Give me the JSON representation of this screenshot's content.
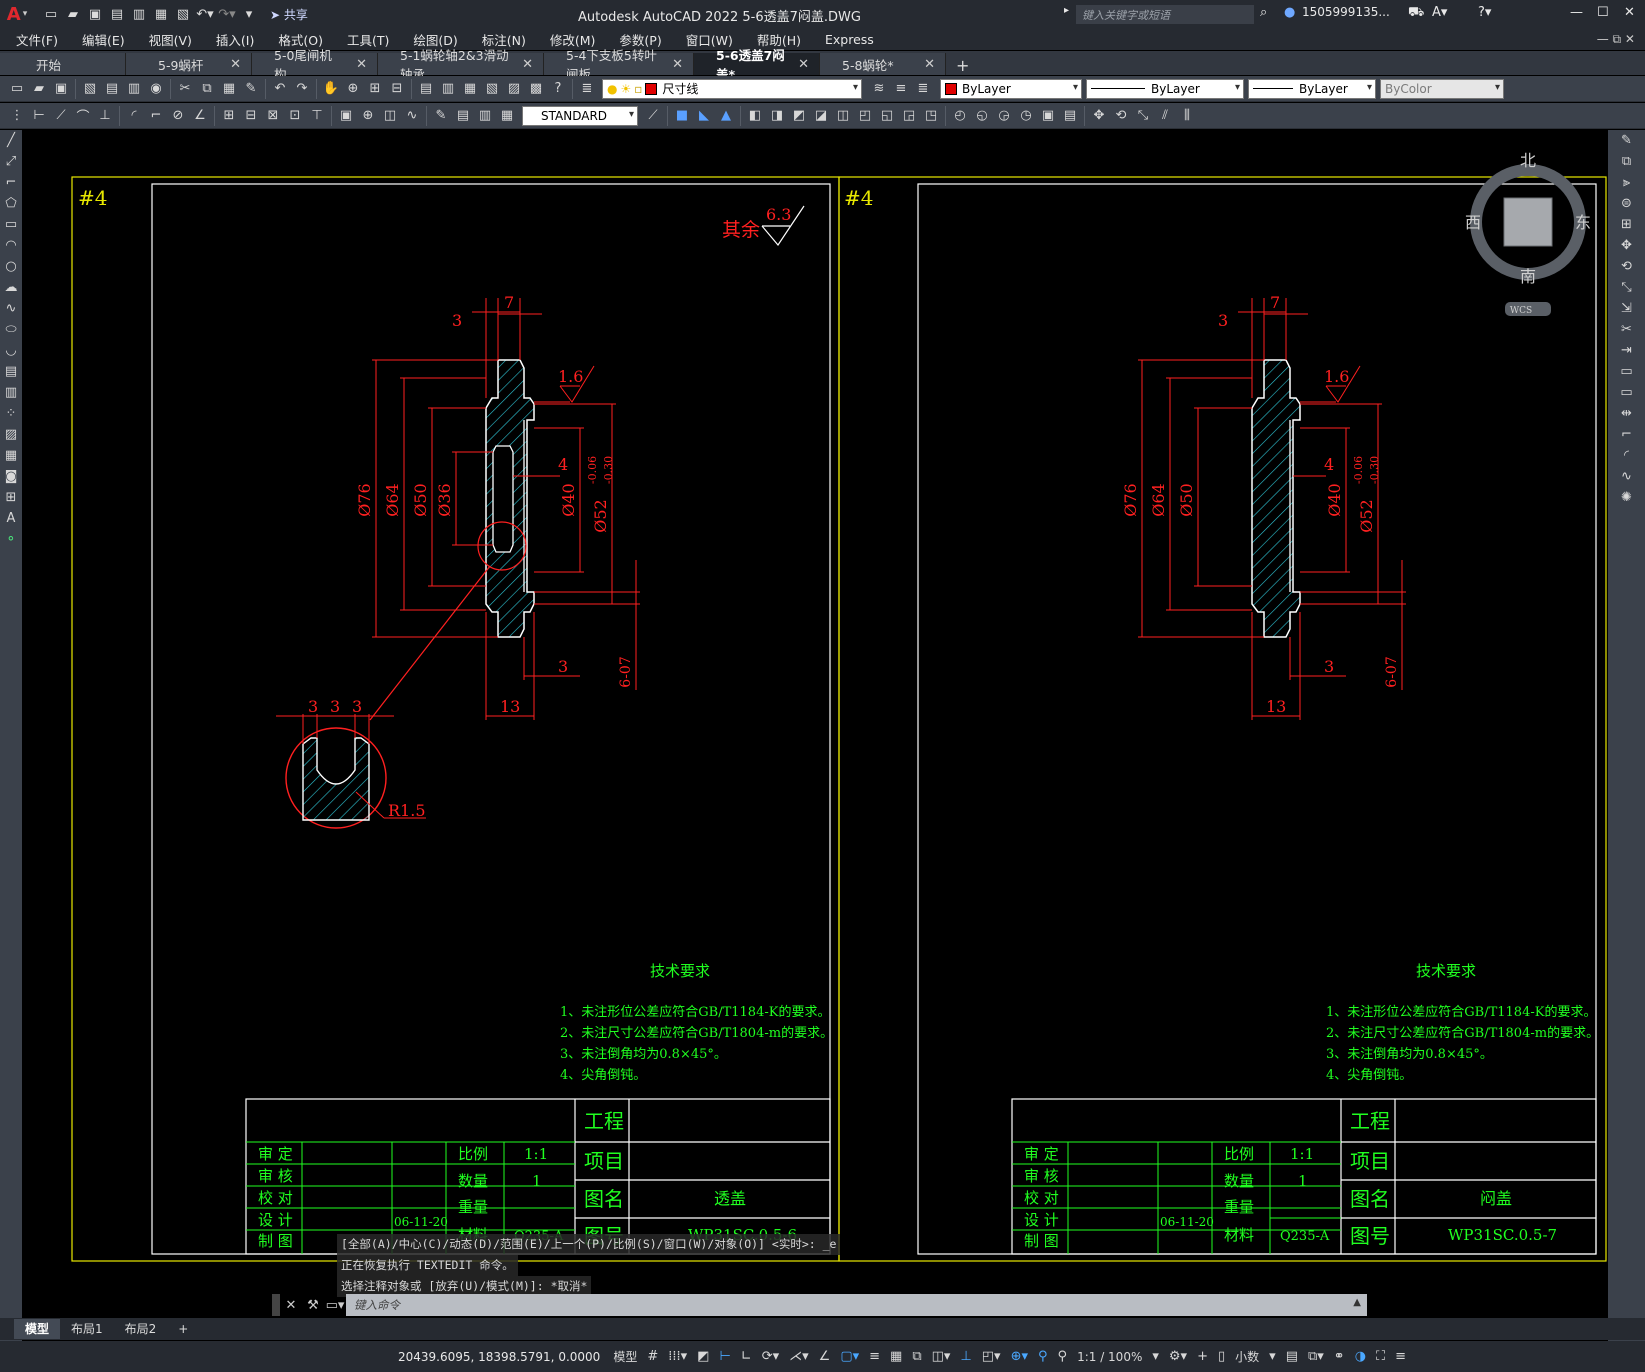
{
  "titlebar": {
    "logo": "A",
    "share": "共享",
    "title": "Autodesk AutoCAD 2022    5-6透盖7闷盖.DWG",
    "search_placeholder": "键入关键字或短语",
    "user": "1505999135...",
    "min": "—",
    "max": "☐",
    "close": "✕"
  },
  "menu": [
    "文件(F)",
    "编辑(E)",
    "视图(V)",
    "插入(I)",
    "格式(O)",
    "工具(T)",
    "绘图(D)",
    "标注(N)",
    "修改(M)",
    "参数(P)",
    "窗口(W)",
    "帮助(H)",
    "Express"
  ],
  "tabs": [
    {
      "label": "开始",
      "closable": false,
      "active": false
    },
    {
      "label": "5-9蜗杆",
      "closable": true,
      "active": false
    },
    {
      "label": "5-0尾闸机构",
      "closable": true,
      "active": false
    },
    {
      "label": "5-1蜗轮轴2&3滑动轴承",
      "closable": true,
      "active": false
    },
    {
      "label": "5-4下支板5转叶闸板",
      "closable": true,
      "active": false
    },
    {
      "label": "5-6透盖7闷盖*",
      "closable": true,
      "active": true
    },
    {
      "label": "5-8蜗轮*",
      "closable": true,
      "active": false
    }
  ],
  "toolbar1": {
    "layer": "尺寸线",
    "color": "ByLayer",
    "linetype": "ByLayer",
    "lineweight": "ByLayer",
    "plotstyle": "ByColor",
    "layer_color": "#e00000"
  },
  "toolbar2": {
    "textstyle": "STANDARD"
  },
  "viewcube": {
    "north": "北",
    "south": "南",
    "east": "东",
    "west": "西",
    "wcs": "WCS"
  },
  "drawing": {
    "sheet_mark": "#4",
    "roughness_other": "其余",
    "roughness_other_val": "6.3",
    "roughness_face": "1.6",
    "dims": {
      "d7": "7",
      "d3a": "3",
      "d4": "4",
      "d3b": "3",
      "d13": "13",
      "phi76": "Ø76",
      "phi64": "Ø64",
      "phi50": "Ø50",
      "phi36": "Ø36",
      "phi40": "Ø40",
      "phi52": "Ø52",
      "tol_up": "-0.06",
      "tol_lo": "-0.30",
      "tol_len": "6-07",
      "detail_3a": "3",
      "detail_3b": "3",
      "detail_3c": "3",
      "r15": "R1.5"
    },
    "tech_title": "技术要求",
    "tech_notes": [
      "1、未注形位公差应符合GB/T1184-K的要求。",
      "2、未注尺寸公差应符合GB/T1804-m的要求。",
      "3、未注倒角均为0.8×45°。",
      "4、尖角倒钝。"
    ],
    "titleblock": {
      "project": "工程",
      "item": "项目",
      "figname": "图名",
      "fignum": "图号",
      "rows_left": [
        "审 定",
        "审 核",
        "校 对",
        "设 计",
        "制 图"
      ],
      "date": "06-11-20",
      "scale_label": "比例",
      "scale_val": "1:1",
      "qty_label": "数量",
      "qty_val": "1",
      "weight_label": "重量",
      "material_label": "材料",
      "material_val": "Q235-A"
    },
    "left_name": "透盖",
    "left_num": "WP31SC.0.5-6",
    "right_name": "闷盖",
    "right_num": "WP31SC.0.5-7"
  },
  "command": {
    "history": [
      "[全部(A)/中心(C)/动态(D)/范围(E)/上一个(P)/比例(S)/窗口(W)/对象(O)] <实时>: _e",
      "正在恢复执行 TEXTEDIT 命令。",
      "选择注释对象或 [放弃(U)/模式(M)]: *取消*"
    ],
    "placeholder": "键入命令"
  },
  "layout_tabs": [
    "模型",
    "布局1",
    "布局2"
  ],
  "status": {
    "coords": "20439.6095, 18398.5791, 0.0000",
    "model": "模型",
    "scale": "1:1 / 100%",
    "units": "小数"
  }
}
